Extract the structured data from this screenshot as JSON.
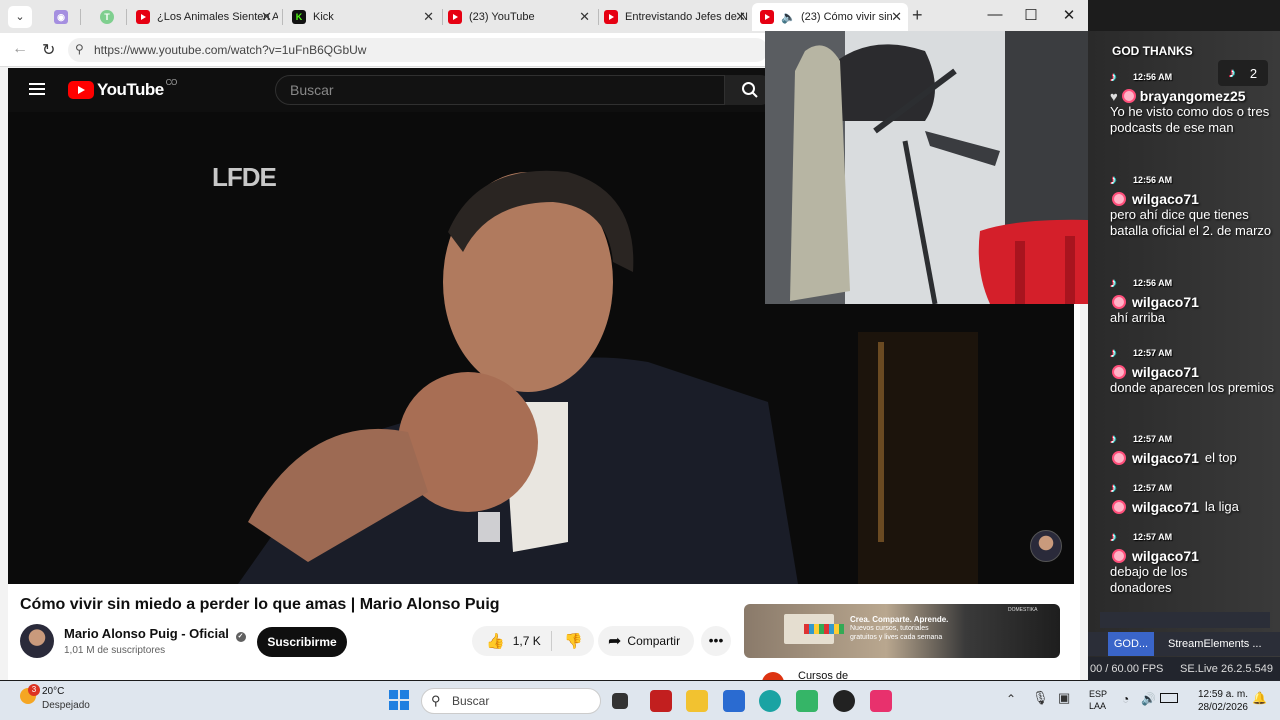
{
  "browser": {
    "tabs": [
      {
        "label": "",
        "icon": "camera-app-icon"
      },
      {
        "label": "",
        "icon": "green-app-icon"
      },
      {
        "label": "¿Los Animales Sienten A",
        "icon": "youtube-icon"
      },
      {
        "label": "Kick",
        "icon": "kick-icon"
      },
      {
        "label": "(23) YouTube",
        "icon": "youtube-icon"
      },
      {
        "label": "Entrevistando Jefes de N",
        "icon": "youtube-icon"
      },
      {
        "label": "(23) Cómo vivir sin",
        "icon": "youtube-icon"
      }
    ],
    "url": "https://www.youtube.com/watch?v=1uFnB6QGbUw"
  },
  "youtube": {
    "logo_text": "YouTube",
    "country_code": "CO",
    "search_placeholder": "Buscar",
    "video_overlay_logo": "LFDE",
    "video_title": "Cómo vivir sin miedo a perder lo que amas | Mario Alonso Puig",
    "channel_name": "Mario Alonso Puig - Oficial",
    "subscribers": "1,01 M de suscriptores",
    "subscribe_label": "Suscribirme",
    "likes": "1,7 K",
    "share_label": "Compartir",
    "ad": {
      "brand": "DOMESTIKA",
      "headline": "Crea. Comparte. Aprende.",
      "line1": "Nuevos cursos, tutoriales",
      "line2": "gratuitos y lives cada semana"
    },
    "next_item_partial": "Cursos de"
  },
  "chat": {
    "header": "GOD THANKS",
    "viewer_count": "2",
    "messages": [
      {
        "time": "12:56 AM",
        "user": "brayangomez25",
        "text": "Yo he visto como dos o tres podcasts de ese man"
      },
      {
        "time": "12:56 AM",
        "user": "wilgaco71",
        "text": "pero ahí dice que tienes batalla oficial el 2. de marzo"
      },
      {
        "time": "12:56 AM",
        "user": "wilgaco71",
        "text": "ahí arriba"
      },
      {
        "time": "12:57 AM",
        "user": "wilgaco71",
        "text": "donde aparecen los premios"
      },
      {
        "time": "12:57 AM",
        "user": "wilgaco71",
        "text": "el top"
      },
      {
        "time": "12:57 AM",
        "user": "wilgaco71",
        "text": "la liga"
      },
      {
        "time": "12:57 AM",
        "user": "wilgaco71",
        "text": "debajo de los donadores"
      }
    ]
  },
  "obs": {
    "dock_tab1": "GOD...",
    "dock_tab2": "StreamElements ...",
    "fps": "00 / 60.00 FPS",
    "version": "SE.Live 26.2.5.549"
  },
  "taskbar": {
    "weather_badge": "3",
    "temperature": "20°C",
    "weather_desc": "Despejado",
    "search_placeholder": "Buscar",
    "lang1": "ESP",
    "lang2": "LAA",
    "time": "12:59 a. m.",
    "date": "28/02/2026"
  }
}
